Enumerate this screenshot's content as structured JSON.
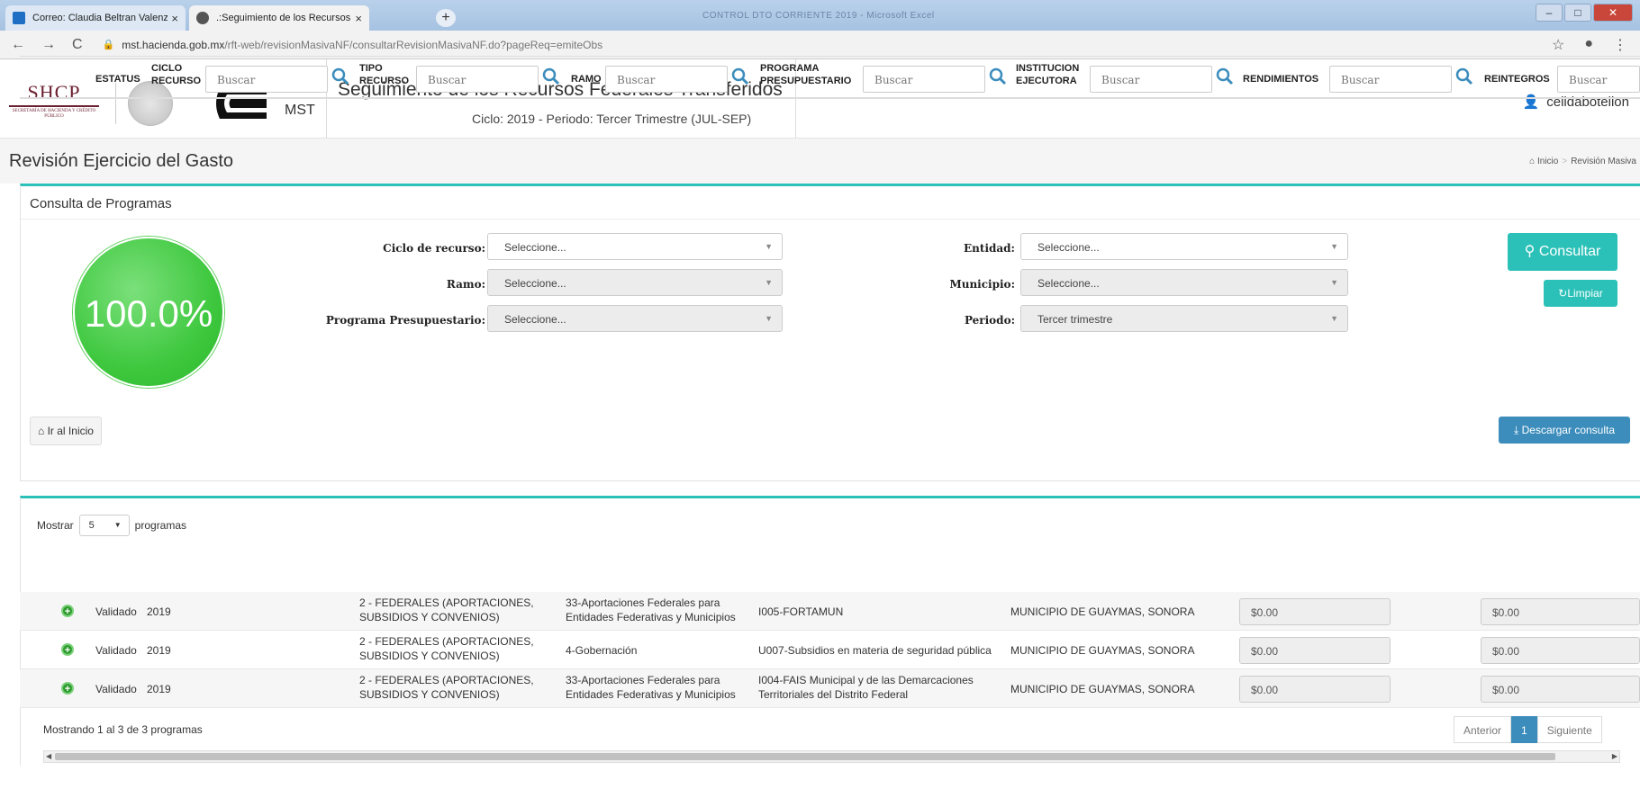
{
  "browser": {
    "tabs": [
      {
        "title": "Correo: Claudia Beltran Valenzue",
        "close": "×"
      },
      {
        "title": ".:Seguimiento de los Recursos Fe",
        "close": "×"
      }
    ],
    "new_tab": "+",
    "window_title": "CONTROL DTO CORRIENTE 2019 - Microsoft Excel",
    "url_host": "mst.hacienda.gob.mx",
    "url_path": "/rft-web/revisionMasivaNF/consultarRevisionMasivaNF.do?pageReq=emiteObs"
  },
  "header": {
    "shcp": "SHCP",
    "shcp_sub": "SECRETARÍA DE HACIENDA Y CRÉDITO PÚBLICO",
    "mst": "MST",
    "title": "Seguimiento de los Recursos Federales Transferidos",
    "subtitle": "Ciclo: 2019 - Periodo: Tercer Trimestre (JUL-SEP)",
    "user": "celidabotellon"
  },
  "page": {
    "title": "Revisión Ejercicio del Gasto",
    "breadcrumb_home": "Inicio",
    "breadcrumb_current": "Revisión Masiva"
  },
  "consulta": {
    "title": "Consulta de Programas",
    "progress": "100.0%",
    "fields": {
      "ciclo_label": "Ciclo de recurso:",
      "ciclo_value": "Seleccione...",
      "ramo_label": "Ramo:",
      "ramo_value": "Seleccione...",
      "programa_label": "Programa Presupuestario:",
      "programa_value": "Seleccione...",
      "entidad_label": "Entidad:",
      "entidad_value": "Seleccione...",
      "municipio_label": "Municipio:",
      "municipio_value": "Seleccione...",
      "periodo_label": "Periodo:",
      "periodo_value": "Tercer trimestre"
    },
    "consultar_button": "Consultar",
    "limpiar_button": "Limpiar",
    "ir_inicio_button": "Ir al Inicio",
    "descargar_button": "Descargar consulta"
  },
  "table": {
    "mostrar_label": "Mostrar",
    "page_size": "5",
    "programas_label": "programas",
    "search_placeholder": "Buscar",
    "headers": {
      "estatus": "ESTATUS",
      "ciclo_1": "CICLO",
      "ciclo_2": "RECURSO",
      "tipo_1": "TIPO",
      "tipo_2": "RECURSO",
      "ramo": "RAMO",
      "programa_1": "PROGRAMA",
      "programa_2": "PRESUPUESTARIO",
      "institucion_1": "INSTITUCION",
      "institucion_2": "EJECUTORA",
      "rendimientos": "RENDIMIENTOS",
      "reintegros": "REINTEGROS"
    },
    "rows": [
      {
        "estatus": "Validado",
        "ciclo": "2019",
        "tipo_1": "2 - FEDERALES (APORTACIONES,",
        "tipo_2": "SUBSIDIOS Y CONVENIOS)",
        "ramo_1": "33-Aportaciones Federales para",
        "ramo_2": "Entidades Federativas y Municipios",
        "programa_1": "I005-FORTAMUN",
        "programa_2": "",
        "institucion": "MUNICIPIO DE GUAYMAS, SONORA",
        "rendimientos": "$0.00",
        "reintegros": "$0.00"
      },
      {
        "estatus": "Validado",
        "ciclo": "2019",
        "tipo_1": "2 - FEDERALES (APORTACIONES,",
        "tipo_2": "SUBSIDIOS Y CONVENIOS)",
        "ramo_1": "4-Gobernación",
        "ramo_2": "",
        "programa_1": "U007-Subsidios en materia de seguridad pública",
        "programa_2": "",
        "institucion": "MUNICIPIO DE GUAYMAS, SONORA",
        "rendimientos": "$0.00",
        "reintegros": "$0.00"
      },
      {
        "estatus": "Validado",
        "ciclo": "2019",
        "tipo_1": "2 - FEDERALES (APORTACIONES,",
        "tipo_2": "SUBSIDIOS Y CONVENIOS)",
        "ramo_1": "33-Aportaciones Federales para",
        "ramo_2": "Entidades Federativas y Municipios",
        "programa_1": "I004-FAIS Municipal y de las Demarcaciones",
        "programa_2": "Territoriales del Distrito Federal",
        "institucion": "MUNICIPIO DE GUAYMAS, SONORA",
        "rendimientos": "$0.00",
        "reintegros": "$0.00"
      }
    ],
    "info": "Mostrando 1 al 3 de 3 programas",
    "pager": {
      "prev": "Anterior",
      "current": "1",
      "next": "Siguiente"
    }
  },
  "colors": {
    "accent": "#2cc1b8",
    "primary": "#3c8dbc",
    "progress": "#3fc83f"
  }
}
